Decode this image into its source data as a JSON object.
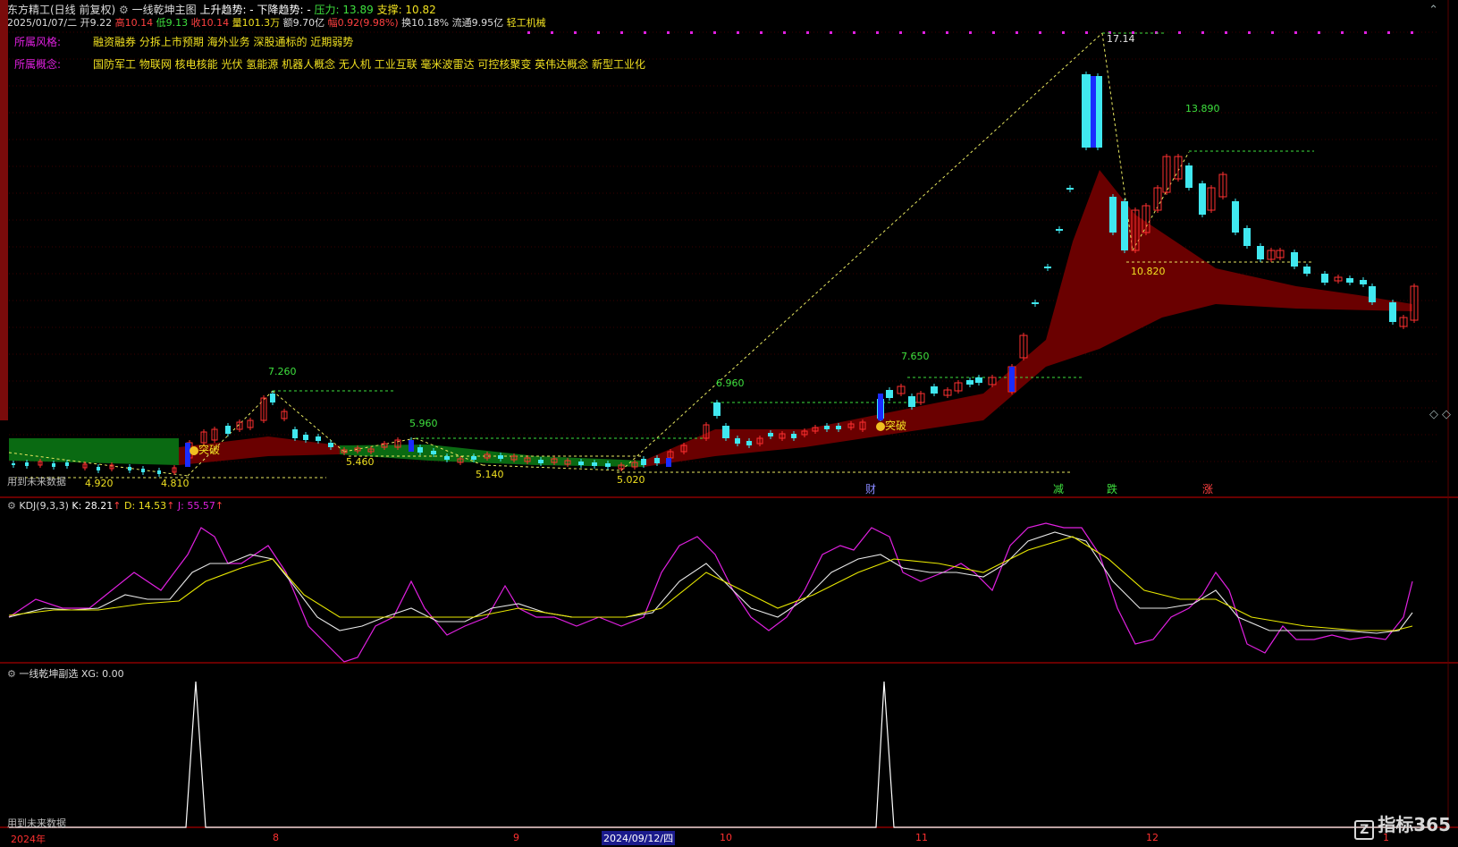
{
  "header": {
    "stock": "东方精工(日线 前复权)",
    "indicator": "一线乾坤主图",
    "up_trend": "上升趋势: -",
    "down_trend": "下降趋势: -",
    "pressure": "压力: 13.89",
    "support": "支撑: 10.82",
    "date": "2025/01/07/二",
    "open": "开9.22",
    "high": "高10.14",
    "low": "低9.13",
    "close": "收10.14",
    "volume": "量101.3万",
    "amount": "额9.70亿",
    "change": "幅0.92(9.98%)",
    "turnover": "换10.18%",
    "float": "流通9.95亿",
    "industry": "轻工机械"
  },
  "info": {
    "style_label": "所属风格:",
    "style_value": "融资融券 分拆上市预期 海外业务 深股通标的 近期弱势",
    "concept_label": "所属概念:",
    "concept_value": "国防军工 物联网 核电核能 光伏 氢能源 机器人概念 无人机 工业互联 毫米波雷达 可控核聚变 英伟达概念 新型工业化"
  },
  "price_labels": {
    "p17_14": "17.14",
    "p13_890": "13.890",
    "p10_820": "10.820",
    "p7_650": "7.650",
    "p6_960": "6.960",
    "p7_260": "7.260",
    "p5_960": "5.960",
    "p5_460": "5.460",
    "p5_140": "5.140",
    "p5_020": "5.020",
    "p4_920": "4.920",
    "p4_810": "4.810"
  },
  "markers": {
    "breakout": "突破",
    "future_data": "用到未来数据",
    "event_cai": "财",
    "event_jian": "减",
    "event_die": "跌",
    "event_zhang": "涨"
  },
  "kdj": {
    "title": "KDJ(9,3,3)",
    "k": "K: 28.21",
    "d": "D: 14.53",
    "j": "J: 55.57"
  },
  "sub": {
    "title": "一线乾坤副选",
    "xg": "XG: 0.00",
    "future_data": "用到未来数据"
  },
  "axis": {
    "year": "2024年",
    "m8": "8",
    "m9": "9",
    "cursor_date": "2024/09/12/四",
    "m10": "10",
    "m11": "11",
    "m12": "12",
    "m1": "1"
  },
  "colors": {
    "up": "#ff3030",
    "down": "#40e8f0",
    "ma_fill_up": "#6a0000",
    "ma_fill_down": "#0a6a12",
    "k_line": "#e8e8e8",
    "d_line": "#e8e800",
    "j_line": "#e020e0"
  },
  "watermark": "指标365"
}
